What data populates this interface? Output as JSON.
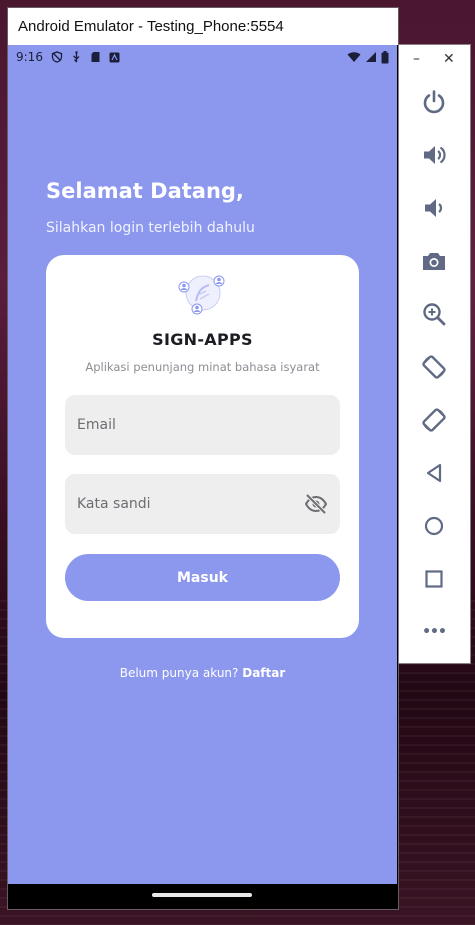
{
  "window": {
    "title": "Android Emulator - Testing_Phone:5554"
  },
  "status_bar": {
    "time": "9:16"
  },
  "welcome": {
    "title": "Selamat Datang,",
    "subtitle": "Silahkan login terlebih dahulu"
  },
  "card": {
    "app_name": "SIGN-APPS",
    "tagline": "Aplikasi penunjang minat bahasa isyarat",
    "email_placeholder": "Email",
    "password_placeholder": "Kata sandi",
    "login_label": "Masuk"
  },
  "register": {
    "prompt": "Belum punya akun?",
    "link": "Daftar"
  },
  "toolbar": {
    "minimize": "–",
    "close": "✕",
    "more": "•••"
  },
  "colors": {
    "screen_background": "#8c97ee",
    "card_background": "#ffffff",
    "field_background": "#eeeeee",
    "toolbar_icon": "#616a85"
  }
}
